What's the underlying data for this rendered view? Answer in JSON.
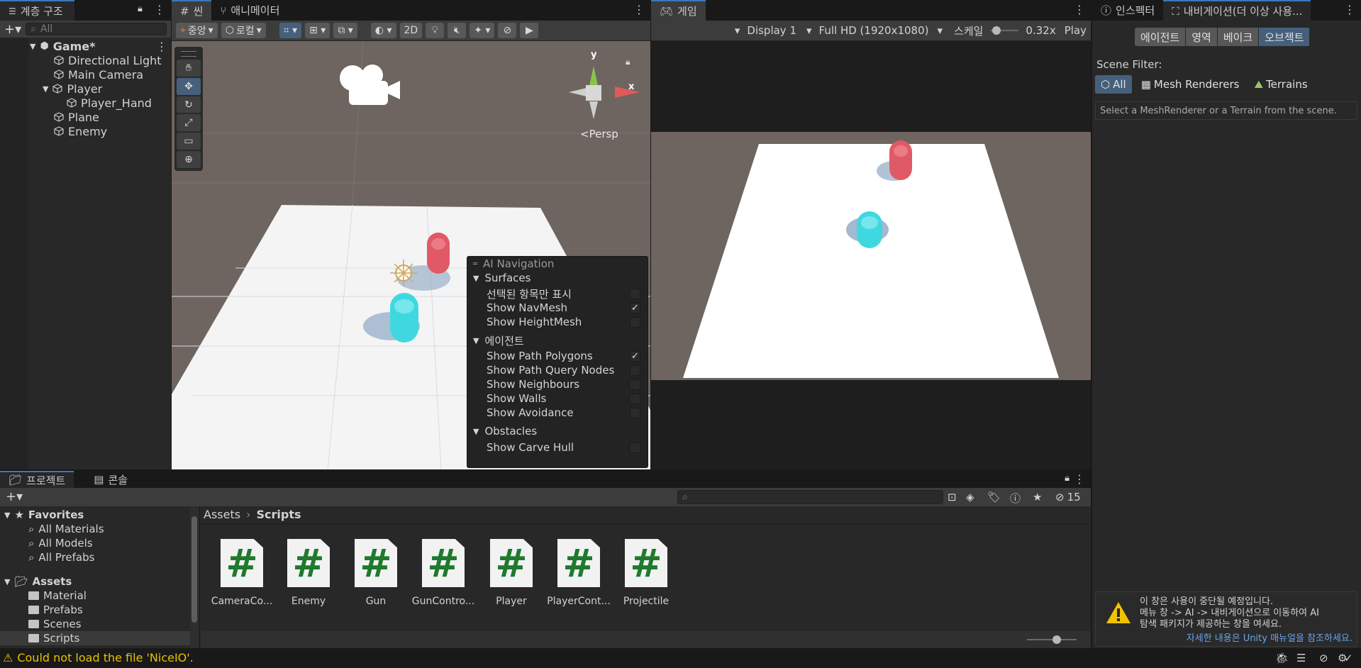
{
  "hierarchy": {
    "tab_label": "계층 구조",
    "search_placeholder": "All",
    "scene_name": "Game*",
    "items": [
      {
        "label": "Directional Light"
      },
      {
        "label": "Main Camera"
      },
      {
        "label": "Player"
      },
      {
        "label": "Player_Hand"
      },
      {
        "label": "Plane"
      },
      {
        "label": "Enemy"
      }
    ]
  },
  "scene": {
    "tabs": [
      {
        "label": "씬"
      },
      {
        "label": "애니메이터"
      }
    ],
    "pivot_label": "중앙",
    "space_label": "로컬",
    "mode_2d": "2D",
    "persp_label": "Persp",
    "gizmo_y": "y",
    "gizmo_x": "x"
  },
  "ai_nav": {
    "title": "AI Navigation",
    "sections": [
      {
        "header": "Surfaces",
        "rows": [
          {
            "label": "선택된 항목만 표시",
            "checked": false
          },
          {
            "label": "Show NavMesh",
            "checked": true
          },
          {
            "label": "Show HeightMesh",
            "checked": false
          }
        ]
      },
      {
        "header": "에이전트",
        "rows": [
          {
            "label": "Show Path Polygons",
            "checked": true
          },
          {
            "label": "Show Path Query Nodes",
            "checked": false
          },
          {
            "label": "Show Neighbours",
            "checked": false
          },
          {
            "label": "Show Walls",
            "checked": false
          },
          {
            "label": "Show Avoidance",
            "checked": false
          }
        ]
      },
      {
        "header": "Obstacles",
        "rows": [
          {
            "label": "Show Carve Hull",
            "checked": false
          }
        ]
      }
    ]
  },
  "game": {
    "tab_label": "게임",
    "display": "Display 1",
    "resolution": "Full HD (1920x1080)",
    "scale_label": "스케일",
    "scale_value": "0.32x",
    "scale_fraction": 0.1,
    "play_label": "Play"
  },
  "inspector": {
    "tabs": [
      {
        "label": "인스펙터"
      },
      {
        "label": "내비게이션(더 이상 사용..."
      }
    ],
    "buttons": [
      {
        "label": "에이전트"
      },
      {
        "label": "영역"
      },
      {
        "label": "베이크"
      },
      {
        "label": "오브젝트"
      }
    ],
    "scene_filter_label": "Scene Filter:",
    "filters": [
      {
        "label": "All"
      },
      {
        "label": "Mesh Renderers"
      },
      {
        "label": "Terrains"
      }
    ],
    "hint": "Select a MeshRenderer or a Terrain from the scene.",
    "warning_lines": [
      "이 창은 사용이 중단될 예정입니다.",
      "메뉴 창 -> AI -> 내비게이션으로 이동하여 AI",
      "탐색 패키지가 제공하는 창을 여세요."
    ],
    "warning_link": "자세한 내용은 Unity 매뉴얼을 참조하세요."
  },
  "project": {
    "tabs": [
      {
        "label": "프로젝트"
      },
      {
        "label": "콘솔"
      }
    ],
    "hidden_count": "15",
    "favorites_label": "Favorites",
    "favorites": [
      {
        "label": "All Materials"
      },
      {
        "label": "All Models"
      },
      {
        "label": "All Prefabs"
      }
    ],
    "assets_label": "Assets",
    "folders": [
      {
        "label": "Material"
      },
      {
        "label": "Prefabs"
      },
      {
        "label": "Scenes"
      },
      {
        "label": "Scripts"
      }
    ],
    "breadcrumb": [
      "Assets",
      "Scripts"
    ],
    "files": [
      {
        "label": "CameraCo..."
      },
      {
        "label": "Enemy"
      },
      {
        "label": "Gun"
      },
      {
        "label": "GunContro..."
      },
      {
        "label": "Player"
      },
      {
        "label": "PlayerCont..."
      },
      {
        "label": "Projectile"
      }
    ]
  },
  "status": {
    "message": "Could not load the file 'NiceIO'."
  },
  "colors": {
    "accent": "#3a79bb",
    "enemy": "#e05a66",
    "player": "#3fd8e0",
    "warning": "#f2c200"
  }
}
